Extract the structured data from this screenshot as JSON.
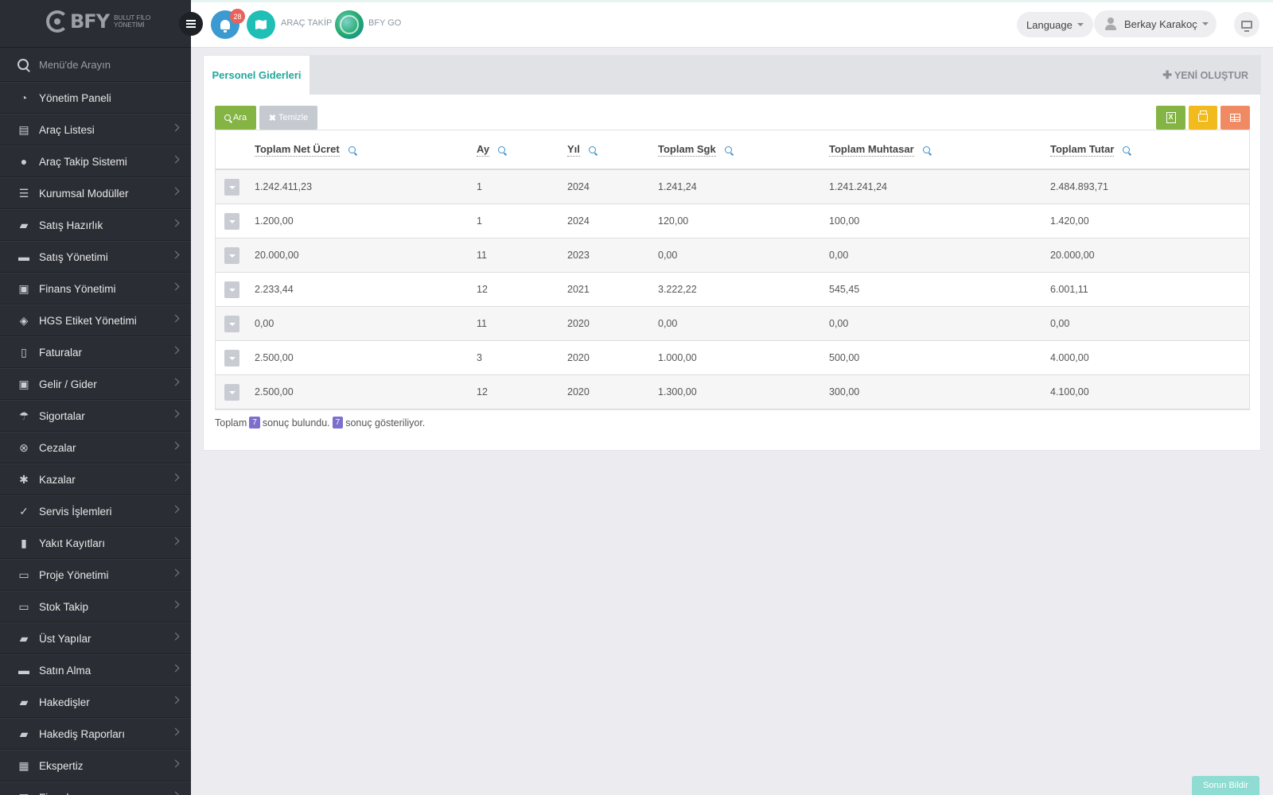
{
  "brand": {
    "name": "BFY",
    "sub_line1": "BULUT FİLO",
    "sub_line2": "YÖNETİMİ"
  },
  "sidebar": {
    "search_placeholder": "Menü'de Arayın",
    "items": [
      {
        "label": "Yönetim Paneli",
        "icon": "gauge-icon",
        "glyph": "◔",
        "has_children": false
      },
      {
        "label": "Araç Listesi",
        "icon": "bus-icon",
        "glyph": "▤",
        "has_children": true
      },
      {
        "label": "Araç Takip Sistemi",
        "icon": "map-pin-icon",
        "glyph": "●",
        "has_children": true
      },
      {
        "label": "Kurumsal Modüller",
        "icon": "server-icon",
        "glyph": "☰",
        "has_children": true
      },
      {
        "label": "Satış Hazırlık",
        "icon": "book-icon",
        "glyph": "▰",
        "has_children": true
      },
      {
        "label": "Satış Yönetimi",
        "icon": "credit-card-icon",
        "glyph": "▬",
        "has_children": true
      },
      {
        "label": "Finans Yönetimi",
        "icon": "money-icon",
        "glyph": "▣",
        "has_children": true
      },
      {
        "label": "HGS Etiket Yönetimi",
        "icon": "tag-icon",
        "glyph": "◈",
        "has_children": true
      },
      {
        "label": "Faturalar",
        "icon": "file-icon",
        "glyph": "▯",
        "has_children": true
      },
      {
        "label": "Gelir / Gider",
        "icon": "money-icon",
        "glyph": "▣",
        "has_children": true
      },
      {
        "label": "Sigortalar",
        "icon": "umbrella-icon",
        "glyph": "☂",
        "has_children": true
      },
      {
        "label": "Cezalar",
        "icon": "times-circle-icon",
        "glyph": "⊗",
        "has_children": true
      },
      {
        "label": "Kazalar",
        "icon": "car-crash-icon",
        "glyph": "✱",
        "has_children": true
      },
      {
        "label": "Servis İşlemleri",
        "icon": "check-circle-icon",
        "glyph": "✓",
        "has_children": true
      },
      {
        "label": "Yakıt Kayıtları",
        "icon": "fuel-icon",
        "glyph": "▮",
        "has_children": true
      },
      {
        "label": "Proje Yönetimi",
        "icon": "briefcase-icon",
        "glyph": "▭",
        "has_children": true
      },
      {
        "label": "Stok Takip",
        "icon": "inbox-icon",
        "glyph": "▭",
        "has_children": true
      },
      {
        "label": "Üst Yapılar",
        "icon": "truck-icon",
        "glyph": "▰",
        "has_children": true
      },
      {
        "label": "Satın Alma",
        "icon": "credit-card-icon",
        "glyph": "▬",
        "has_children": true
      },
      {
        "label": "Hakedişler",
        "icon": "truck-icon",
        "glyph": "▰",
        "has_children": true
      },
      {
        "label": "Hakediş Raporları",
        "icon": "truck-icon",
        "glyph": "▰",
        "has_children": true
      },
      {
        "label": "Ekspertiz",
        "icon": "list-alt-icon",
        "glyph": "▦",
        "has_children": true
      },
      {
        "label": "Firmalar",
        "icon": "building-icon",
        "glyph": "▦",
        "has_children": true
      }
    ]
  },
  "topbar": {
    "notification_count": "28",
    "arac_takip_label": "ARAÇ TAKİP",
    "bfy_go_label": "BFY GO",
    "language_label": "Language",
    "user_name": "Berkay Karakoç"
  },
  "panel": {
    "tab_label": "Personel Giderleri",
    "new_label": "YENİ OLUŞTUR",
    "search_label": "Ara",
    "clear_label": "Temizle",
    "excel_glyph": "X",
    "columns": [
      "Toplam Net Ücret",
      "Ay",
      "Yıl",
      "Toplam Sgk",
      "Toplam Muhtasar",
      "Toplam Tutar"
    ],
    "rows": [
      [
        "1.242.411,23",
        "1",
        "2024",
        "1.241,24",
        "1.241.241,24",
        "2.484.893,71"
      ],
      [
        "1.200,00",
        "1",
        "2024",
        "120,00",
        "100,00",
        "1.420,00"
      ],
      [
        "20.000,00",
        "11",
        "2023",
        "0,00",
        "0,00",
        "20.000,00"
      ],
      [
        "2.233,44",
        "12",
        "2021",
        "3.222,22",
        "545,45",
        "6.001,11"
      ],
      [
        "0,00",
        "11",
        "2020",
        "0,00",
        "0,00",
        "0,00"
      ],
      [
        "2.500,00",
        "3",
        "2020",
        "1.000,00",
        "500,00",
        "4.000,00"
      ],
      [
        "2.500,00",
        "12",
        "2020",
        "1.300,00",
        "300,00",
        "4.100,00"
      ]
    ],
    "summary": {
      "prefix": "Toplam",
      "found_count": "7",
      "found_text": "sonuç bulundu.",
      "shown_count": "7",
      "shown_text": "sonuç gösteriliyor."
    }
  },
  "report_button": "Sorun Bildir",
  "colors": {
    "sidebar_bg": "#2a2d33",
    "accent_teal": "#1ea89c",
    "btn_green": "#84b544",
    "btn_yellow": "#f2bb1d",
    "btn_orange": "#f08a62",
    "badge_purple": "#7c6fcd",
    "notif_red": "#e8625a"
  }
}
